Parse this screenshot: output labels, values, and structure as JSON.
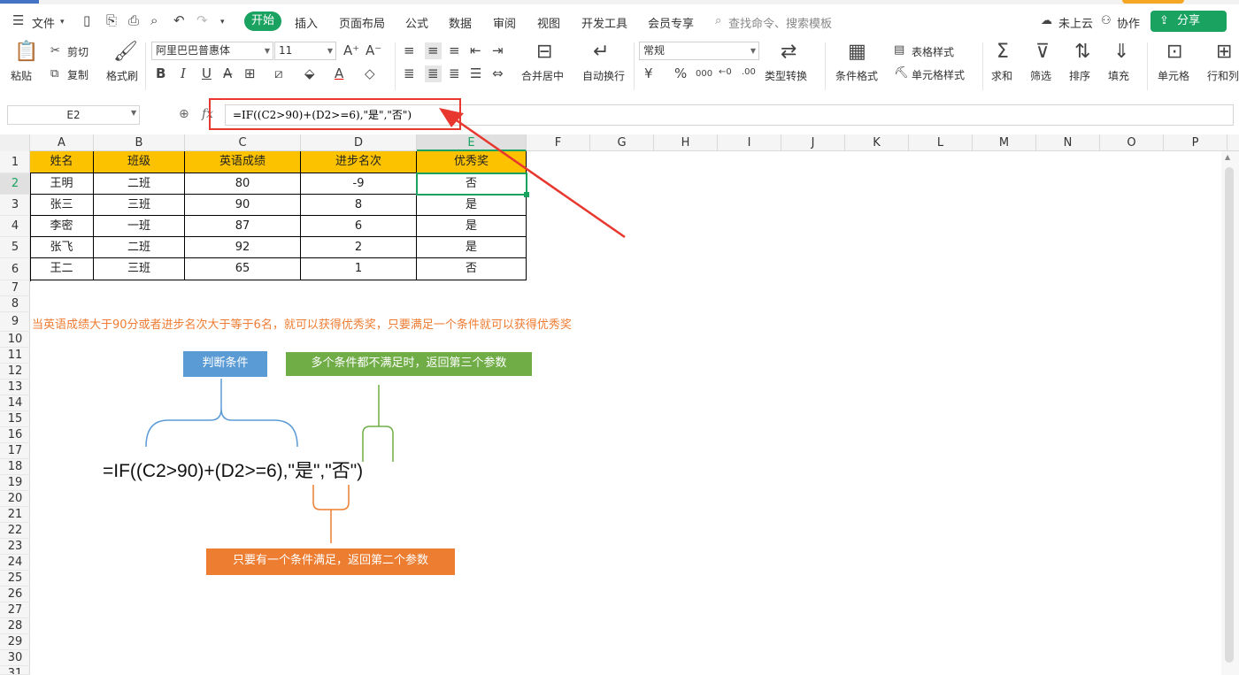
{
  "menu": {
    "file": "文件",
    "tabs": [
      "开始",
      "插入",
      "页面布局",
      "公式",
      "数据",
      "审阅",
      "视图",
      "开发工具",
      "会员专享"
    ],
    "search_placeholder": "查找命令、搜索模板",
    "cloud": "未上云",
    "collab": "协作",
    "share": "分享"
  },
  "ribbon": {
    "paste": "粘贴",
    "cut": "剪切",
    "copy": "复制",
    "format_painter": "格式刷",
    "font_name": "阿里巴巴普惠体",
    "font_size": "11",
    "bold": "B",
    "italic": "I",
    "underline": "U",
    "merge": "合并居中",
    "wrap": "自动换行",
    "number_format": "常规",
    "type_convert": "类型转换",
    "cond_format": "条件格式",
    "table_style": "表格样式",
    "cell_style": "单元格样式",
    "sum": "求和",
    "filter": "筛选",
    "sort": "排序",
    "fill": "填充",
    "cell": "单元格",
    "rowcol": "行和列",
    "yen": "¥",
    "percent": "%"
  },
  "formula_bar": {
    "name_box": "E2",
    "fx": "fx",
    "formula": "=IF((C2>90)+(D2>=6),\"是\",\"否\")"
  },
  "columns": [
    "A",
    "B",
    "C",
    "D",
    "E",
    "F",
    "G",
    "H",
    "I",
    "J",
    "K",
    "L",
    "M",
    "N",
    "O",
    "P"
  ],
  "rows": [
    "1",
    "2",
    "3",
    "4",
    "5",
    "6",
    "7",
    "8",
    "9",
    "10",
    "11",
    "12",
    "13",
    "14",
    "15",
    "16",
    "17",
    "18",
    "19",
    "20",
    "21",
    "22",
    "23",
    "24",
    "25",
    "26",
    "27",
    "28",
    "29",
    "30",
    "31"
  ],
  "table": {
    "headers": [
      "姓名",
      "班级",
      "英语成绩",
      "进步名次",
      "优秀奖"
    ],
    "rows": [
      [
        "王明",
        "二班",
        "80",
        "-9",
        "否"
      ],
      [
        "张三",
        "三班",
        "90",
        "8",
        "是"
      ],
      [
        "李密",
        "一班",
        "87",
        "6",
        "是"
      ],
      [
        "张飞",
        "二班",
        "92",
        "2",
        "是"
      ],
      [
        "王二",
        "三班",
        "65",
        "1",
        "否"
      ]
    ]
  },
  "annotation": {
    "note": "当英语成绩大于90分或者进步名次大于等于6名，就可以获得优秀奖，只要满足一个条件就可以获得优秀奖",
    "condition_label": "判断条件",
    "false_label": "多个条件都不满足时，返回第三个参数",
    "true_label": "只要有一个条件满足，返回第二个参数",
    "big_formula": "=IF((C2>90)+(D2>=6),\"是\",\"否\")"
  },
  "colors": {
    "accent_green": "#1aa260",
    "header_fill": "#fcc200",
    "note_orange": "#ef7c32",
    "blue_box": "#5b9bd5",
    "green_box": "#70ad47",
    "orange_box": "#ed7d31",
    "red_arrow": "#e8372f"
  }
}
